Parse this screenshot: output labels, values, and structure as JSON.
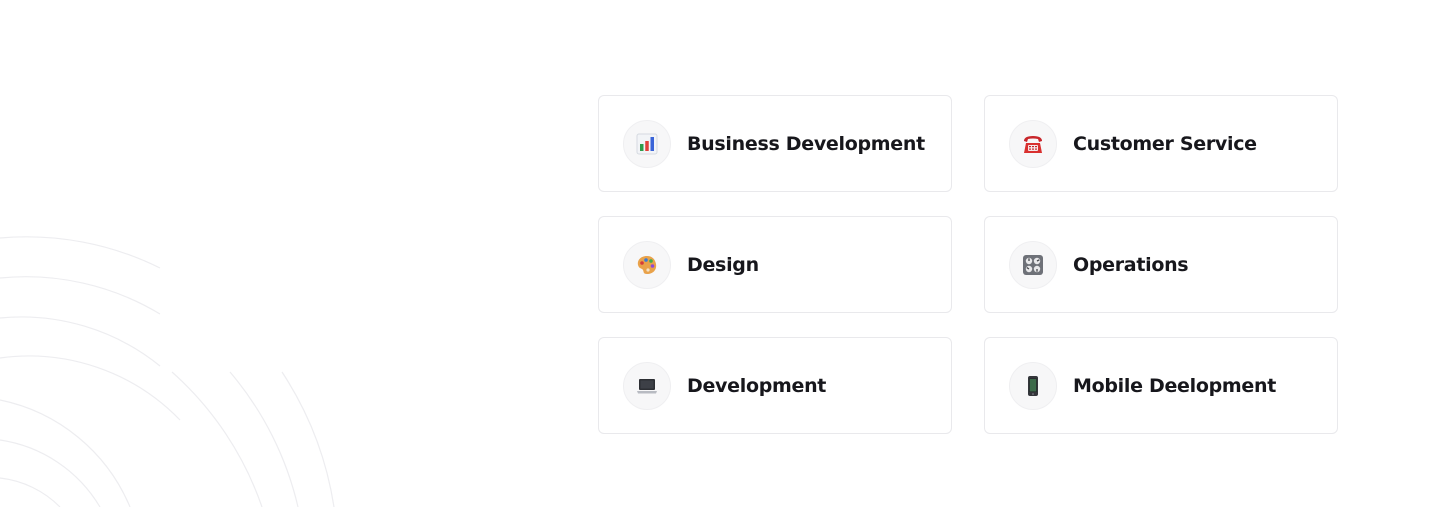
{
  "categories": [
    {
      "label": "Business Development",
      "icon": "bar-chart-icon"
    },
    {
      "label": "Customer Service",
      "icon": "telephone-icon"
    },
    {
      "label": "Design",
      "icon": "palette-icon"
    },
    {
      "label": "Operations",
      "icon": "control-knobs-icon"
    },
    {
      "label": "Development",
      "icon": "laptop-icon"
    },
    {
      "label": "Mobile Deelopment",
      "icon": "mobile-phone-icon"
    }
  ],
  "colors": {
    "card_border": "#e9e9ec",
    "icon_bg": "#f7f7f8",
    "label_text": "#17171c",
    "arc_stroke": "#ececf0"
  }
}
